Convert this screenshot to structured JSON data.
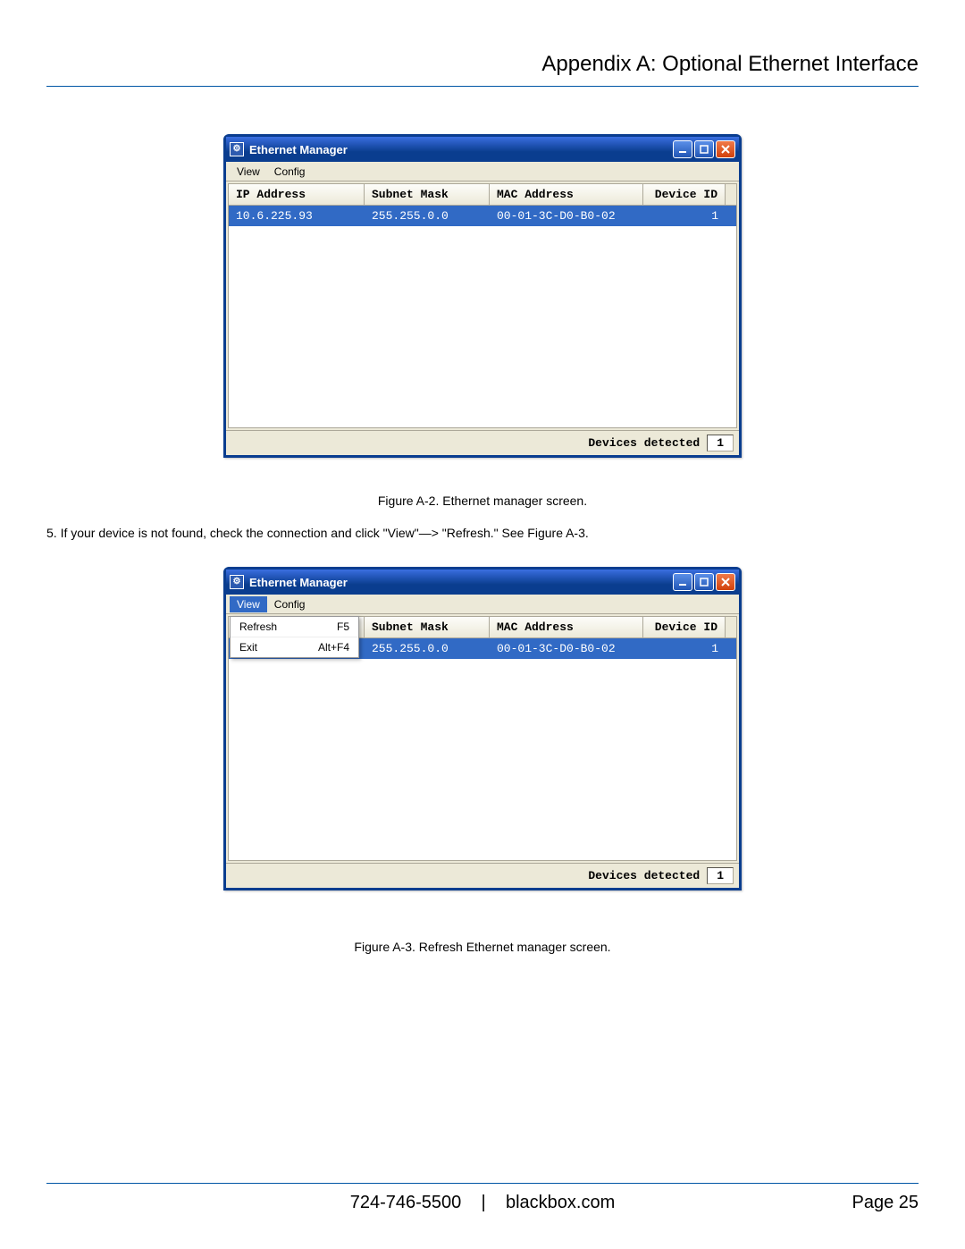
{
  "header": {
    "title": "Appendix A: Optional Ethernet Interface"
  },
  "window": {
    "title": "Ethernet Manager",
    "menubar": {
      "view": "View",
      "config": "Config"
    },
    "dropdown": {
      "refresh_label": "Refresh",
      "refresh_key": "F5",
      "exit_label": "Exit",
      "exit_key": "Alt+F4"
    },
    "columns": {
      "ip": "IP Address",
      "mask": "Subnet Mask",
      "mac": "MAC Address",
      "id": "Device ID"
    },
    "row": {
      "ip": "10.6.225.93",
      "mask": "255.255.0.0",
      "mac": "00-01-3C-D0-B0-02",
      "id": "1"
    },
    "status_label": "Devices detected",
    "status_count": "1"
  },
  "captions": {
    "fig1": "Figure A-2. Ethernet manager screen.",
    "instruction": "5. If your device is not found, check the connection and click \"View\"—> \"Refresh.\" See Figure A-3.",
    "fig2": "Figure A-3. Refresh Ethernet manager screen."
  },
  "footer": {
    "phone": "724-746-5500",
    "divider": "|",
    "site": "blackbox.com",
    "page": "Page 25"
  }
}
